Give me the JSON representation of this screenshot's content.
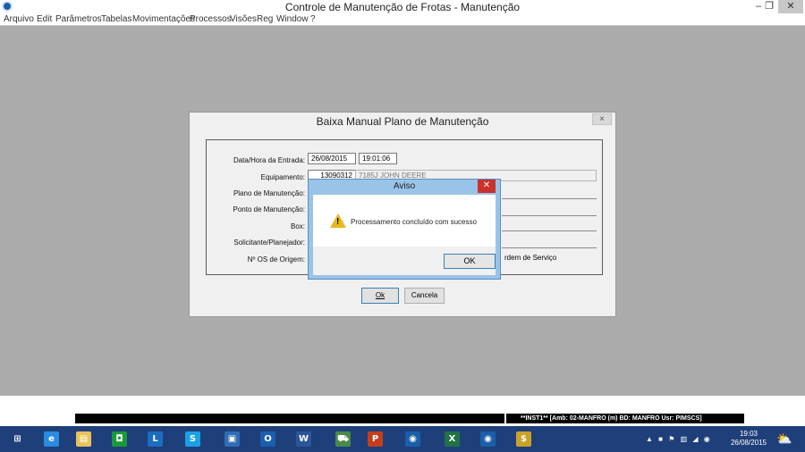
{
  "window": {
    "title": "Controle de Manutenção de Frotas - Manutenção",
    "minimize": "–",
    "restore": "❐",
    "close": "✕"
  },
  "menu": [
    "Arquivo",
    "Edit",
    "Parâmetros",
    "Tabelas",
    "Movimentações",
    "Processos",
    "Visões",
    "Reg",
    "Window",
    "?"
  ],
  "dialog": {
    "title": "Baixa Manual Plano de Manutenção",
    "close": "×",
    "fields": {
      "data_hora_label": "Data/Hora da Entrada:",
      "date": "26/08/2015",
      "time": "19:01:06",
      "equipamento_label": "Equipamento:",
      "equipamento_code": "13090312",
      "equipamento_desc": "7185J JOHN DEERE",
      "plano_label": "Plano de Manutenção:",
      "ponto_label": "Ponto de Manutenção:",
      "box_label": "Box:",
      "solicitante_label": "Solicitante/Planejador:",
      "os_origem_label": "Nº OS de Origem:",
      "ordem_servico_text": "rdem de Serviço"
    },
    "ok_label": "Ok",
    "cancel_label": "Cancela"
  },
  "aviso": {
    "title": "Aviso",
    "close": "✕",
    "message": "Processamento concluído com sucesso",
    "ok_label": "OK",
    "icon": "warning-icon"
  },
  "status": {
    "right_text": "**INST1**  [Amb: 02-MANFRO  (m) BD: MANFRO Usr: PIMSCS]"
  },
  "taskbar": {
    "apps": [
      {
        "name": "start",
        "glyph": "⊞",
        "color": "#1f3f7a"
      },
      {
        "name": "internet-explorer",
        "glyph": "e",
        "color": "#2a8be0"
      },
      {
        "name": "file-explorer",
        "glyph": "▤",
        "color": "#e8c35a"
      },
      {
        "name": "store",
        "glyph": "◘",
        "color": "#1a9a3a"
      },
      {
        "name": "lync",
        "glyph": "L",
        "color": "#1b6cc2"
      },
      {
        "name": "skype",
        "glyph": "S",
        "color": "#1aa0e6"
      },
      {
        "name": "remote-desktop",
        "glyph": "▣",
        "color": "#2f6db5"
      },
      {
        "name": "outlook",
        "glyph": "O",
        "color": "#1b5fae"
      },
      {
        "name": "word",
        "glyph": "W",
        "color": "#2b579a"
      },
      {
        "name": "truck-app",
        "glyph": "⛟",
        "color": "#4a8a4a"
      },
      {
        "name": "powerpoint",
        "glyph": "P",
        "color": "#c43e1c"
      },
      {
        "name": "app-circle-1",
        "glyph": "◉",
        "color": "#1a5fa8"
      },
      {
        "name": "excel",
        "glyph": "X",
        "color": "#217346"
      },
      {
        "name": "app-circle-2",
        "glyph": "◉",
        "color": "#1a5fa8"
      },
      {
        "name": "money-app",
        "glyph": "$",
        "color": "#c9a227"
      }
    ],
    "clock_time": "19:03",
    "clock_date": "26/08/2015",
    "tray_icons": "▲  ■  ⚑  ▥  ◢  ◉"
  },
  "colors": {
    "workspace": "#ababab",
    "aviso_frame": "#9ac3e8",
    "aviso_close": "#c9332b",
    "taskbar": "#1f3f7a"
  }
}
